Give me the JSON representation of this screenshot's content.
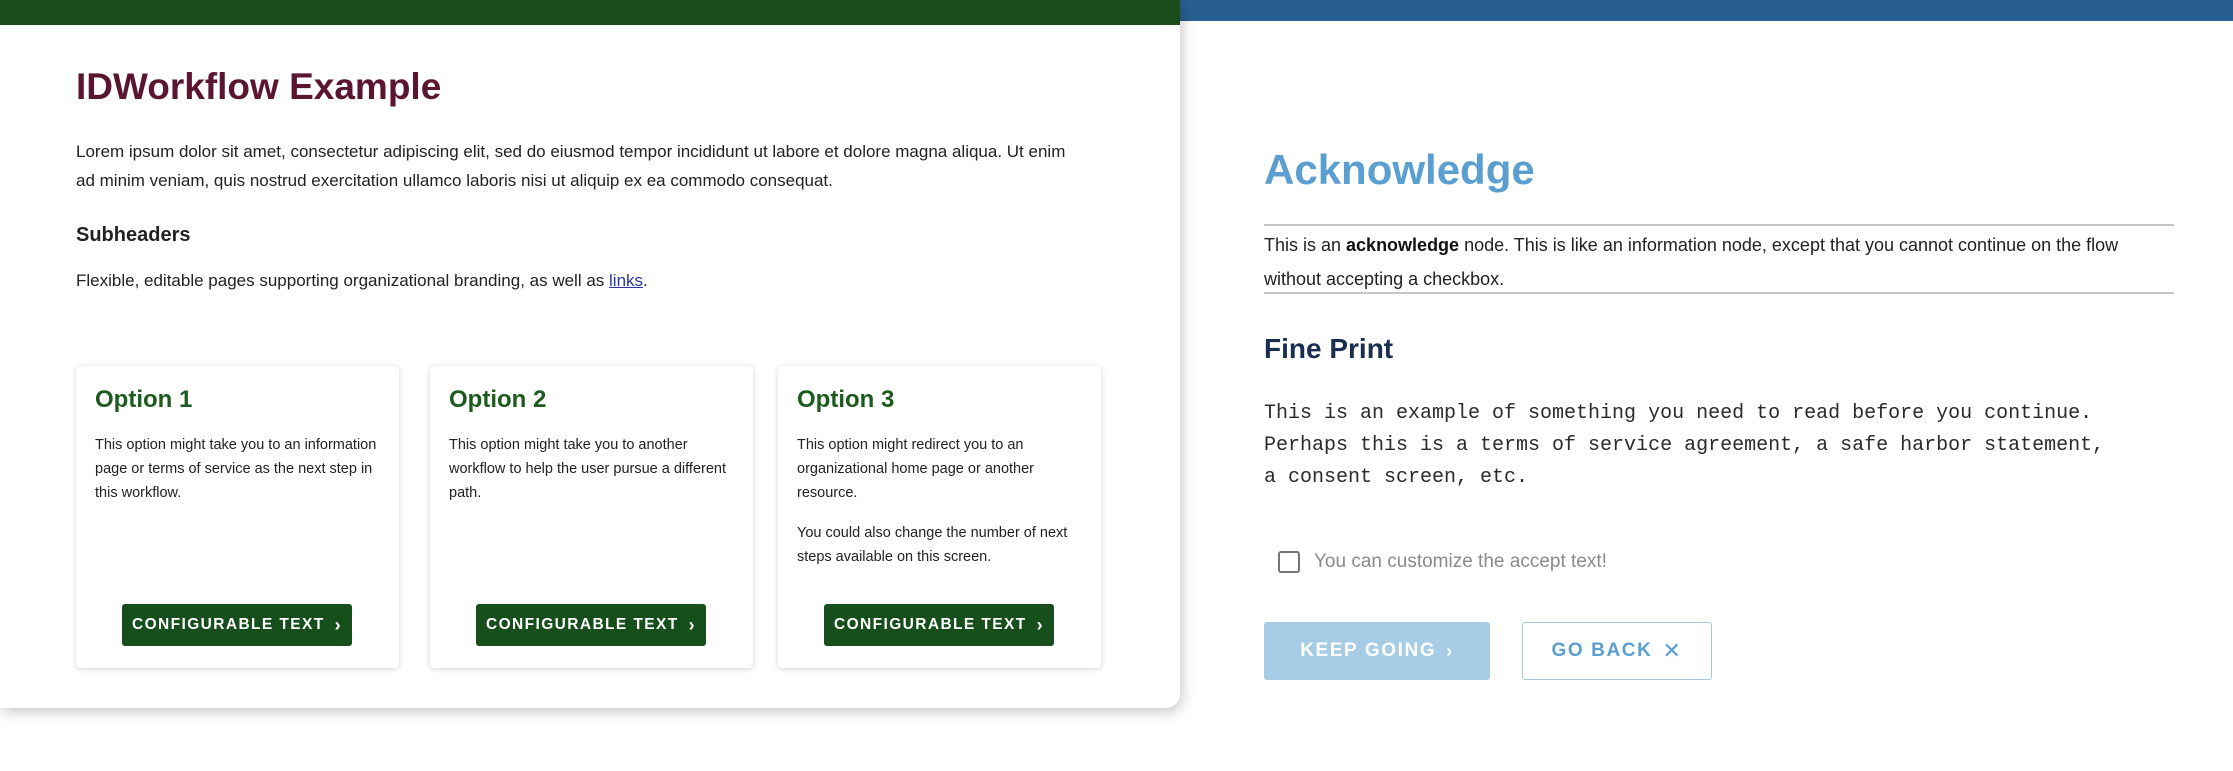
{
  "left": {
    "title": "IDWorkflow Example",
    "intro": "Lorem ipsum dolor sit amet, consectetur adipiscing elit, sed do eiusmod tempor incididunt ut labore et dolore magna aliqua. Ut enim ad minim veniam, quis nostrud exercitation ullamco laboris nisi ut aliquip ex ea commodo consequat.",
    "subheader": "Subheaders",
    "subtext_before": "Flexible, editable pages supporting organizational branding, as well as ",
    "subtext_link": "links",
    "subtext_after": ".",
    "cards": [
      {
        "title": "Option 1",
        "paragraphs": [
          "This option might take you to an information page or terms of service as the next step in this workflow."
        ],
        "button": "CONFIGURABLE TEXT"
      },
      {
        "title": "Option 2",
        "paragraphs": [
          "This option might take you to another workflow to help the user pursue a different path."
        ],
        "button": "CONFIGURABLE TEXT"
      },
      {
        "title": "Option 3",
        "paragraphs": [
          "This option might redirect you to an organizational home page or another resource.",
          "You could also change the number of next steps available on this screen."
        ],
        "button": "CONFIGURABLE TEXT"
      }
    ]
  },
  "right": {
    "title": "Acknowledge",
    "intro_before": "This is an ",
    "intro_bold": "acknowledge",
    "intro_after": " node. This is like an information node, except that you cannot continue on the flow without accepting a checkbox.",
    "fine_print_title": "Fine Print",
    "fine_print_lines": [
      "This is an example of something you need to read before you continue.",
      "Perhaps this is a terms of service agreement, a safe harbor statement,",
      "a consent screen, etc."
    ],
    "accept_label": "You can customize the accept text!",
    "accept_checked": false,
    "keep_button": "KEEP GOING",
    "back_button": "GO BACK"
  },
  "colors": {
    "left_topbar": "#1b4d1c",
    "left_title": "#5a1531",
    "card_title": "#1d5a1e",
    "card_button": "#174f1c",
    "link": "#2a36a8",
    "right_topbar": "#285f92",
    "right_title": "#5a9fd0",
    "fine_print_title": "#1a2e52",
    "keep_button_disabled": "#a7cde6"
  },
  "icons": {
    "card_button": "chevron-right-icon",
    "keep_button": "chevron-right-icon",
    "back_button": "close-icon"
  }
}
